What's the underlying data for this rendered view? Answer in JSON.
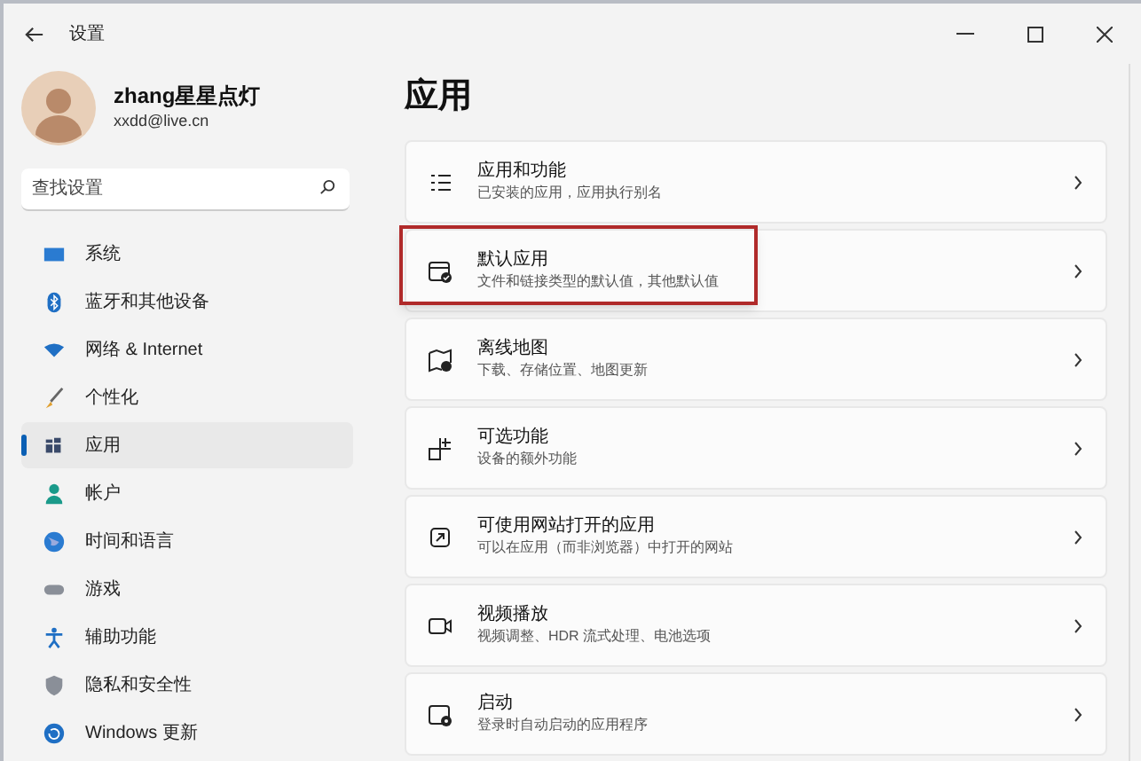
{
  "window": {
    "title": "设置"
  },
  "profile": {
    "name": "zhang星星点灯",
    "email": "xxdd@live.cn"
  },
  "search": {
    "placeholder": "查找设置"
  },
  "sidebar": {
    "items": [
      {
        "label": "系统",
        "selected": false
      },
      {
        "label": "蓝牙和其他设备",
        "selected": false
      },
      {
        "label": "网络 & Internet",
        "selected": false
      },
      {
        "label": "个性化",
        "selected": false
      },
      {
        "label": "应用",
        "selected": true
      },
      {
        "label": "帐户",
        "selected": false
      },
      {
        "label": "时间和语言",
        "selected": false
      },
      {
        "label": "游戏",
        "selected": false
      },
      {
        "label": "辅助功能",
        "selected": false
      },
      {
        "label": "隐私和安全性",
        "selected": false
      },
      {
        "label": "Windows 更新",
        "selected": false
      }
    ]
  },
  "page": {
    "title": "应用"
  },
  "cards": [
    {
      "title": "应用和功能",
      "subtitle": "已安装的应用，应用执行别名",
      "highlighted": false
    },
    {
      "title": "默认应用",
      "subtitle": "文件和链接类型的默认值，其他默认值",
      "highlighted": true
    },
    {
      "title": "离线地图",
      "subtitle": "下载、存储位置、地图更新",
      "highlighted": false
    },
    {
      "title": "可选功能",
      "subtitle": "设备的额外功能",
      "highlighted": false
    },
    {
      "title": "可使用网站打开的应用",
      "subtitle": "可以在应用（而非浏览器）中打开的网站",
      "highlighted": false
    },
    {
      "title": "视频播放",
      "subtitle": "视频调整、HDR 流式处理、电池选项",
      "highlighted": false
    },
    {
      "title": "启动",
      "subtitle": "登录时自动启动的应用程序",
      "highlighted": false
    }
  ]
}
